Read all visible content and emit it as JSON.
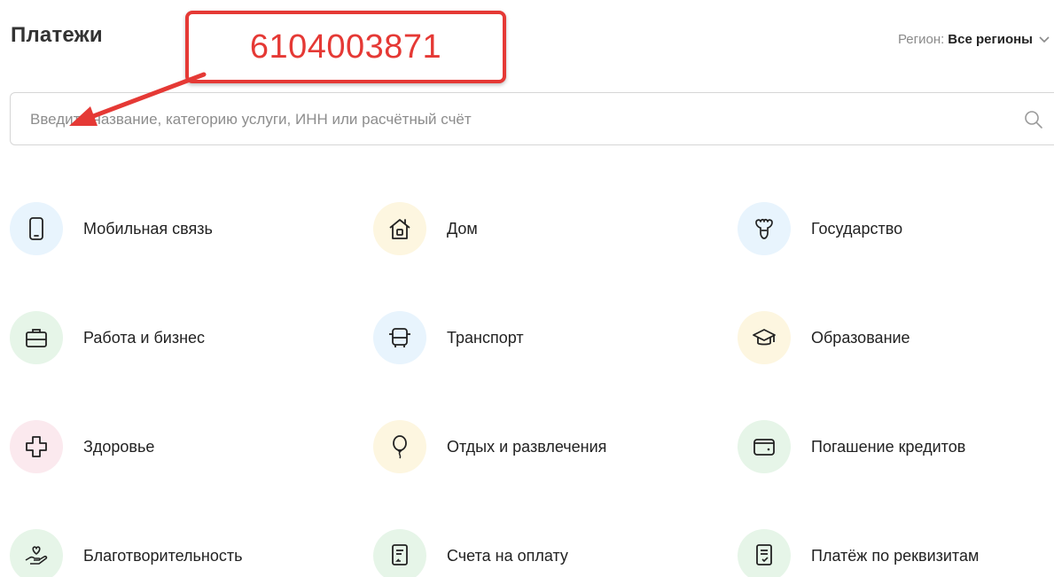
{
  "header": {
    "title": "Платежи",
    "region_label": "Регион:",
    "region_value": "Все регионы"
  },
  "search": {
    "placeholder": "Введите название, категорию услуги, ИНН или расчётный счёт",
    "value": ""
  },
  "annotation": {
    "text": "6104003871",
    "color": "#e53935"
  },
  "categories": [
    {
      "label": "Мобильная связь",
      "icon": "phone-icon"
    },
    {
      "label": "Дом",
      "icon": "house-icon"
    },
    {
      "label": "Государство",
      "icon": "coat-of-arms-icon"
    },
    {
      "label": "Работа и бизнес",
      "icon": "briefcase-icon"
    },
    {
      "label": "Транспорт",
      "icon": "bus-icon"
    },
    {
      "label": "Образование",
      "icon": "graduation-cap-icon"
    },
    {
      "label": "Здоровье",
      "icon": "medical-cross-icon"
    },
    {
      "label": "Отдых и развлечения",
      "icon": "balloon-icon"
    },
    {
      "label": "Погашение кредитов",
      "icon": "wallet-icon"
    },
    {
      "label": "Благотворительность",
      "icon": "heart-hand-icon"
    },
    {
      "label": "Счета на оплату",
      "icon": "invoice-icon"
    },
    {
      "label": "Платёж по реквизитам",
      "icon": "document-check-icon"
    }
  ],
  "colors": {
    "accent": "#e53935",
    "icon_stroke": "#222222",
    "bg_blue": "#e8f4fd",
    "bg_yellow": "#fdf6e0",
    "bg_green": "#e6f5e8",
    "bg_pink": "#fbe9ee"
  }
}
